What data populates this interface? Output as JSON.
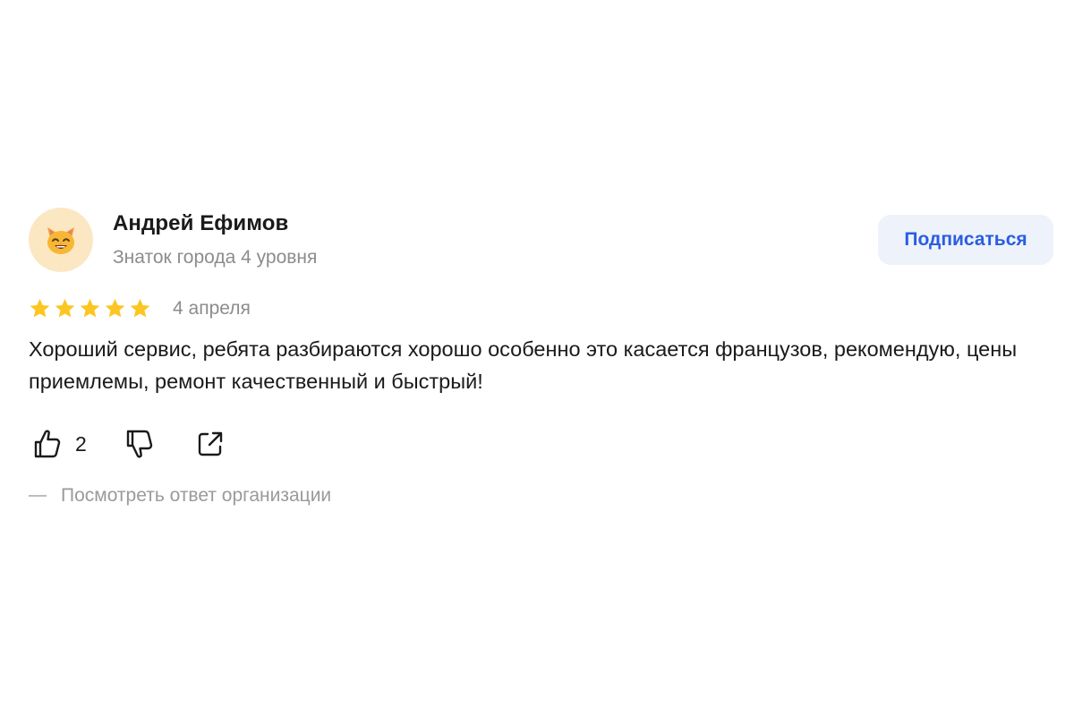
{
  "review": {
    "author": {
      "name": "Андрей Ефимов",
      "level": "Знаток города 4 уровня",
      "avatar_icon": "cat-face-emoji-icon"
    },
    "subscribe_label": "Подписаться",
    "rating": {
      "stars": 5,
      "max": 5,
      "star_color": "#fcc521"
    },
    "date": "4 апреля",
    "text": "Хороший сервис, ребята разбираются хорошо особенно это касается французов, рекомендую, цены приемлемы, ремонт качественный и быстрый!",
    "actions": {
      "like_icon": "thumbs-up-icon",
      "like_count": "2",
      "dislike_icon": "thumbs-down-icon",
      "share_icon": "share-external-icon"
    },
    "org_answer_link": "Посмотреть ответ организации"
  },
  "colors": {
    "accent": "#2a5de0",
    "button_bg": "#eef2fb",
    "muted_text": "#8c8c8c",
    "avatar_bg": "#fbe7c2"
  }
}
